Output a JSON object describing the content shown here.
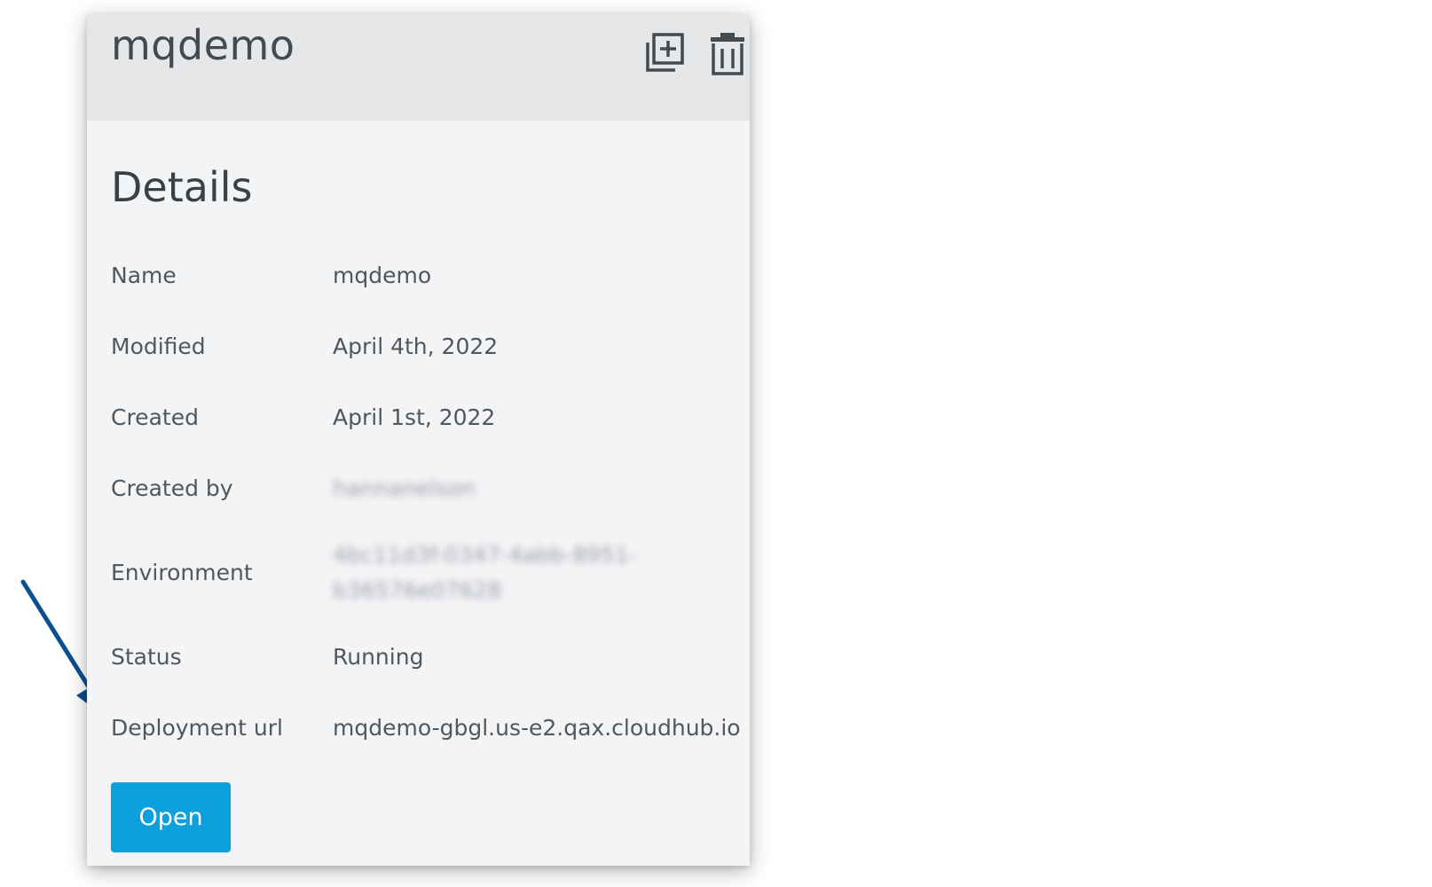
{
  "header": {
    "app_name": "mqdemo",
    "copy_icon": "copy-plus-icon",
    "delete_icon": "trash-icon"
  },
  "details": {
    "heading": "Details",
    "rows": [
      {
        "label": "Name",
        "value": "mqdemo"
      },
      {
        "label": "Modified",
        "value": "April 4th, 2022"
      },
      {
        "label": "Created",
        "value": "April 1st, 2022"
      },
      {
        "label": "Created by",
        "value": "hannanelson"
      },
      {
        "label": "Environment",
        "value_line1": "4bc11d3f-0347-4abb-8951-",
        "value_line2": "b36576e07628"
      },
      {
        "label": "Status",
        "value": "Running"
      },
      {
        "label": "Deployment url",
        "value": "mqdemo-gbgl.us-e2.qax.cloudhub.io"
      }
    ],
    "open_label": "Open"
  },
  "colors": {
    "accent": "#0da0dd",
    "arrow": "#0b4f8f",
    "header_bg": "#e6e7e9",
    "panel_bg": "#f3f4f6"
  },
  "annotation": {
    "arrow_icon": "arrow-icon"
  }
}
